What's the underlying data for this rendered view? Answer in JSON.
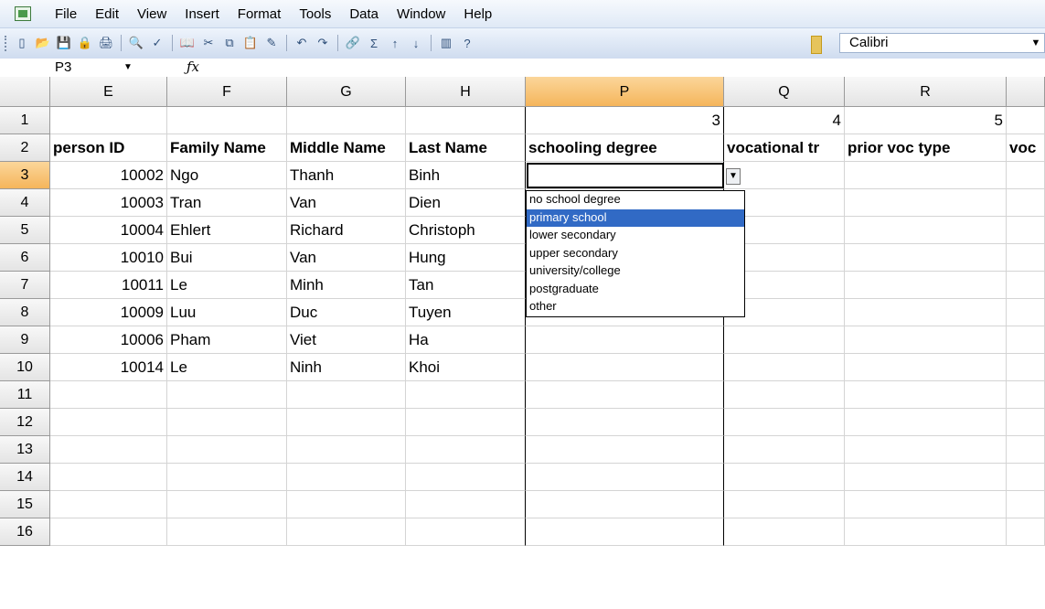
{
  "menu": [
    "File",
    "Edit",
    "View",
    "Insert",
    "Format",
    "Tools",
    "Data",
    "Window",
    "Help"
  ],
  "toolbar": {
    "icons": [
      "new-icon",
      "open-icon",
      "save-icon",
      "permission-icon",
      "print-icon",
      "|",
      "print-preview-icon",
      "spelling-icon",
      "|",
      "research-icon",
      "cut-icon",
      "copy-icon",
      "paste-icon",
      "format-painter-icon",
      "|",
      "undo-icon",
      "redo-icon",
      "|",
      "hyperlink-icon",
      "autosum-icon",
      "sort-asc-icon",
      "sort-desc-icon",
      "|",
      "chart-icon",
      "help-icon"
    ],
    "font_name": "Calibri"
  },
  "formula_bar": {
    "name_box": "P3",
    "fx": "fx",
    "value": ""
  },
  "columns": [
    "E",
    "F",
    "G",
    "H",
    "P",
    "Q",
    "R",
    ""
  ],
  "selected_column": "P",
  "rows": [
    {
      "num": "1",
      "cells": [
        "",
        "",
        "",
        "",
        "3",
        "4",
        "5",
        ""
      ]
    },
    {
      "num": "2",
      "cells": [
        "person ID",
        "Family Name",
        "Middle Name",
        "Last Name",
        "schooling degree",
        "vocational tr",
        "prior voc type",
        "voc"
      ]
    },
    {
      "num": "3",
      "cells": [
        "10002",
        "Ngo",
        "Thanh",
        "Binh",
        "",
        "",
        "",
        ""
      ]
    },
    {
      "num": "4",
      "cells": [
        "10003",
        "Tran",
        "Van",
        "Dien",
        "",
        "",
        "",
        ""
      ]
    },
    {
      "num": "5",
      "cells": [
        "10004",
        "Ehlert",
        "Richard",
        "Christoph",
        "",
        "",
        "",
        ""
      ]
    },
    {
      "num": "6",
      "cells": [
        "10010",
        "Bui",
        "Van",
        "Hung",
        "",
        "",
        "",
        ""
      ]
    },
    {
      "num": "7",
      "cells": [
        "10011",
        "Le",
        "Minh",
        "Tan",
        "",
        "",
        "",
        ""
      ]
    },
    {
      "num": "8",
      "cells": [
        "10009",
        "Luu",
        "Duc",
        "Tuyen",
        "",
        "",
        "",
        ""
      ]
    },
    {
      "num": "9",
      "cells": [
        "10006",
        "Pham",
        "Viet",
        "Ha",
        "",
        "",
        "",
        ""
      ]
    },
    {
      "num": "10",
      "cells": [
        "10014",
        "Le",
        "Ninh",
        "Khoi",
        "",
        "",
        "",
        ""
      ]
    },
    {
      "num": "11",
      "cells": [
        "",
        "",
        "",
        "",
        "",
        "",
        "",
        ""
      ]
    },
    {
      "num": "12",
      "cells": [
        "",
        "",
        "",
        "",
        "",
        "",
        "",
        ""
      ]
    },
    {
      "num": "13",
      "cells": [
        "",
        "",
        "",
        "",
        "",
        "",
        "",
        ""
      ]
    },
    {
      "num": "14",
      "cells": [
        "",
        "",
        "",
        "",
        "",
        "",
        "",
        ""
      ]
    },
    {
      "num": "15",
      "cells": [
        "",
        "",
        "",
        "",
        "",
        "",
        "",
        ""
      ]
    },
    {
      "num": "16",
      "cells": [
        "",
        "",
        "",
        "",
        "",
        "",
        "",
        ""
      ]
    }
  ],
  "dropdown": {
    "options": [
      "no school degree",
      "primary school",
      "lower secondary",
      "upper secondary",
      "university/college",
      "postgraduate",
      "other"
    ],
    "highlighted": "primary school"
  }
}
